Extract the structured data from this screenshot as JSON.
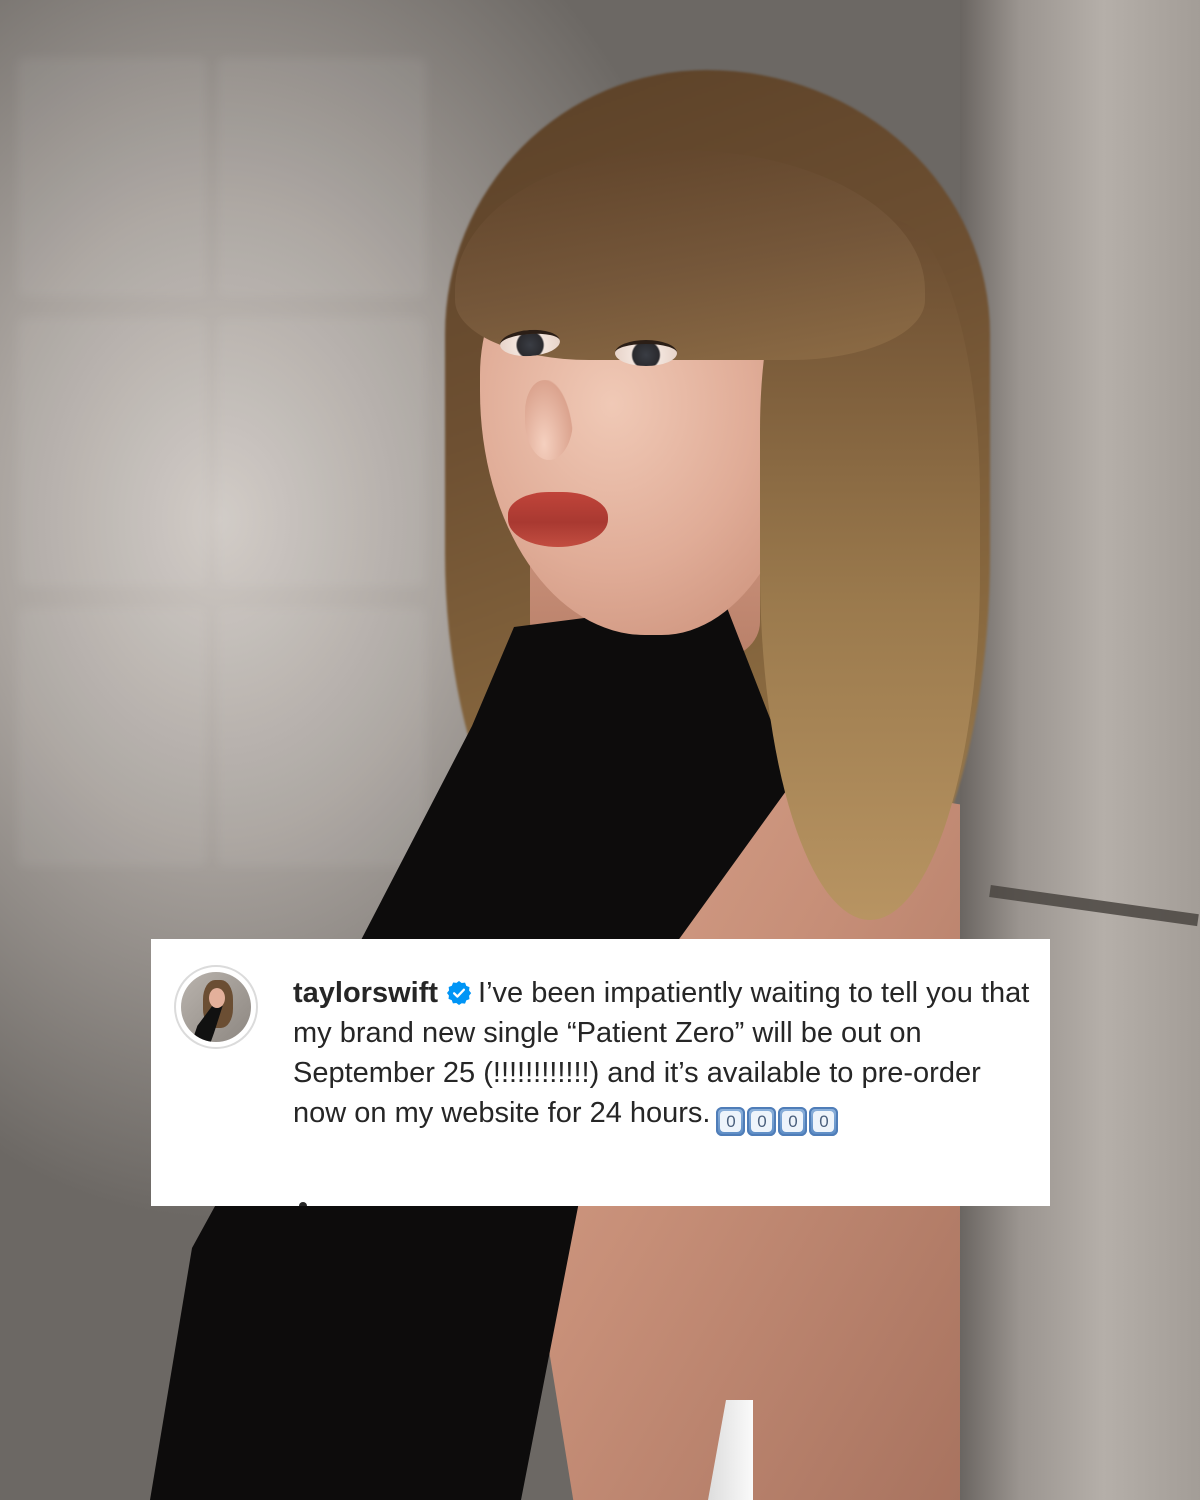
{
  "photo": {
    "alt": ""
  },
  "caption": {
    "username": "taylorswift",
    "verified_icon": "verified-badge-icon",
    "text": "I’ve been impatiently waiting to tell you that my brand new single “Patient Zero” will be out on September 25 (!!!!!!!!!!!!) and it’s available to pre-order now on my website for 24 hours.",
    "keycaps": [
      "0",
      "0",
      "0",
      "0"
    ],
    "colors": {
      "verified": "#0095f6",
      "text": "#262626",
      "card": "#ffffff"
    }
  }
}
